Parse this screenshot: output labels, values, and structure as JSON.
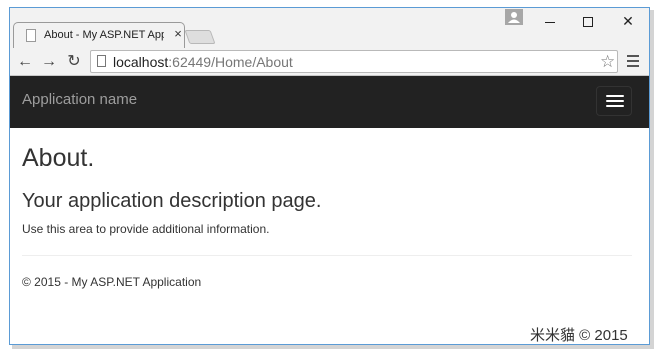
{
  "browser": {
    "tab_title": "About - My ASP.NET Appl",
    "tab_close": "×",
    "url_host": "localhost",
    "url_rest": ":62449/Home/About",
    "window_controls": [
      "minimize-icon",
      "maximize-icon",
      "close-icon"
    ],
    "close_glyph": "✕",
    "nav_icons": [
      "back-arrow-icon",
      "forward-arrow-icon",
      "reload-icon"
    ],
    "back_glyph": "←",
    "forward_glyph": "→",
    "reload_glyph": "↻",
    "star_glyph": "☆"
  },
  "navbar": {
    "brand": "Application name",
    "background": "#222222",
    "brand_color": "#9d9d9d"
  },
  "main": {
    "title": "About.",
    "subtitle": "Your application description page.",
    "body": "Use this area to provide additional information.",
    "footer": "© 2015 - My ASP.NET Application"
  },
  "watermark": "米米貓 © 2015"
}
